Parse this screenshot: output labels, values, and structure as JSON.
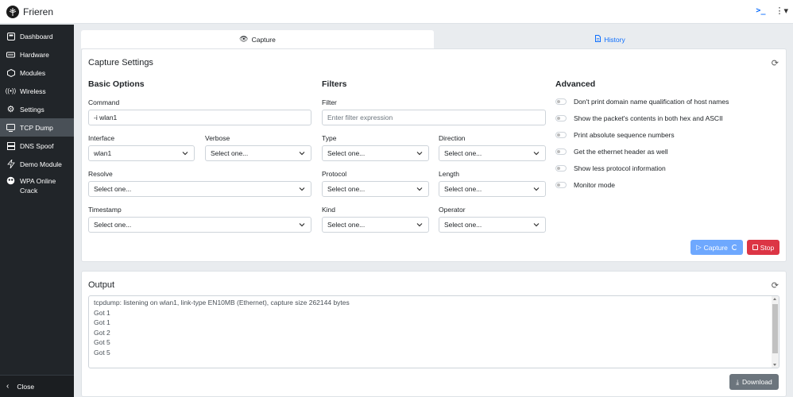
{
  "app": {
    "title": "Frieren"
  },
  "sidebar": {
    "items": [
      {
        "label": "Dashboard",
        "icon": "dashboard-icon",
        "active": false
      },
      {
        "label": "Hardware",
        "icon": "hardware-icon",
        "active": false
      },
      {
        "label": "Modules",
        "icon": "modules-icon",
        "active": false
      },
      {
        "label": "Wireless",
        "icon": "wireless-icon",
        "active": false
      },
      {
        "label": "Settings",
        "icon": "gear-icon",
        "active": false
      },
      {
        "label": "TCP Dump",
        "icon": "tcpdump-icon",
        "active": true
      },
      {
        "label": "DNS Spoof",
        "icon": "dns-icon",
        "active": false
      },
      {
        "label": "Demo Module",
        "icon": "bolt-icon",
        "active": false
      },
      {
        "label": "WPA Online Crack",
        "icon": "crack-icon",
        "active": false
      }
    ],
    "close_label": "Close"
  },
  "tabs": [
    {
      "label": "Capture",
      "icon": "eye-icon",
      "active": true
    },
    {
      "label": "History",
      "icon": "file-icon",
      "active": false
    }
  ],
  "settings": {
    "title": "Capture Settings",
    "basic": {
      "heading": "Basic Options",
      "command_label": "Command",
      "command_value": "-i wlan1",
      "interface_label": "Interface",
      "interface_value": "wlan1",
      "verbose_label": "Verbose",
      "verbose_value": "Select one...",
      "resolve_label": "Resolve",
      "resolve_value": "Select one...",
      "timestamp_label": "Timestamp",
      "timestamp_value": "Select one..."
    },
    "filters": {
      "heading": "Filters",
      "filter_label": "Filter",
      "filter_placeholder": "Enter filter expression",
      "type_label": "Type",
      "type_value": "Select one...",
      "direction_label": "Direction",
      "direction_value": "Select one...",
      "protocol_label": "Protocol",
      "protocol_value": "Select one...",
      "length_label": "Length",
      "length_value": "Select one...",
      "kind_label": "Kind",
      "kind_value": "Select one...",
      "operator_label": "Operator",
      "operator_value": "Select one..."
    },
    "advanced": {
      "heading": "Advanced",
      "options": [
        "Don't print domain name qualification of host names",
        "Show the packet's contents in both hex and ASCII",
        "Print absolute sequence numbers",
        "Get the ethernet header as well",
        "Show less protocol information",
        "Monitor mode"
      ]
    },
    "capture_label": "Capture",
    "stop_label": "Stop"
  },
  "output": {
    "title": "Output",
    "lines": [
      "tcpdump: listening on wlan1, link-type EN10MB (Ethernet), capture size 262144 bytes",
      "Got 1",
      "Got 1",
      "Got 2",
      "Got 5",
      "Got 5"
    ],
    "download_label": "Download"
  },
  "colors": {
    "sidebar_bg": "#212529",
    "sidebar_active": "#495057",
    "primary": "#0d6efd",
    "capture_btn": "#6ea8fe",
    "stop_btn": "#dc3545",
    "download_btn": "#6c757d"
  }
}
